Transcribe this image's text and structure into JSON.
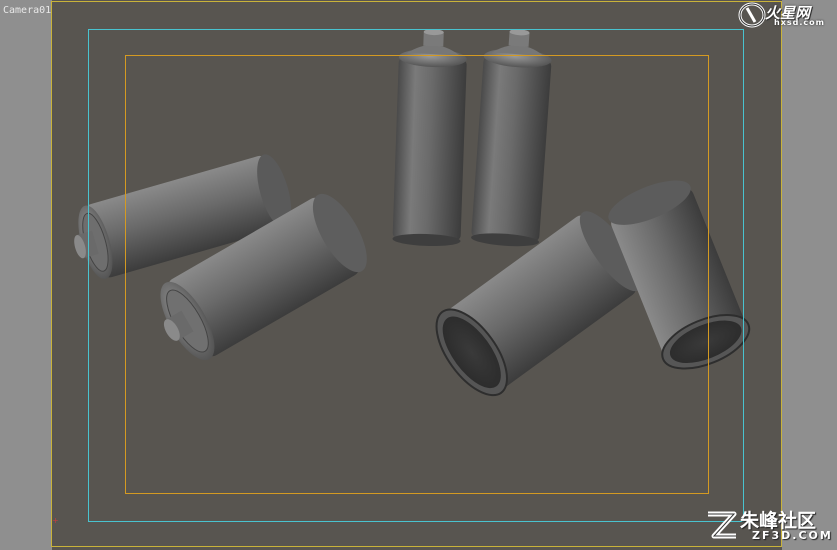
{
  "viewport": {
    "camera_label": "Camera01"
  },
  "watermarks": {
    "top_brand": "火星网",
    "top_site": "hxsd.com",
    "bottom_brand": "朱峰社区",
    "bottom_site": "ZF3D.COM"
  },
  "colors": {
    "background": "#585550",
    "side_panels": "#8f8f8f",
    "frame_outer": "#c9b33a",
    "safe_action": "#49c3cf",
    "safe_title": "#d49a22"
  }
}
